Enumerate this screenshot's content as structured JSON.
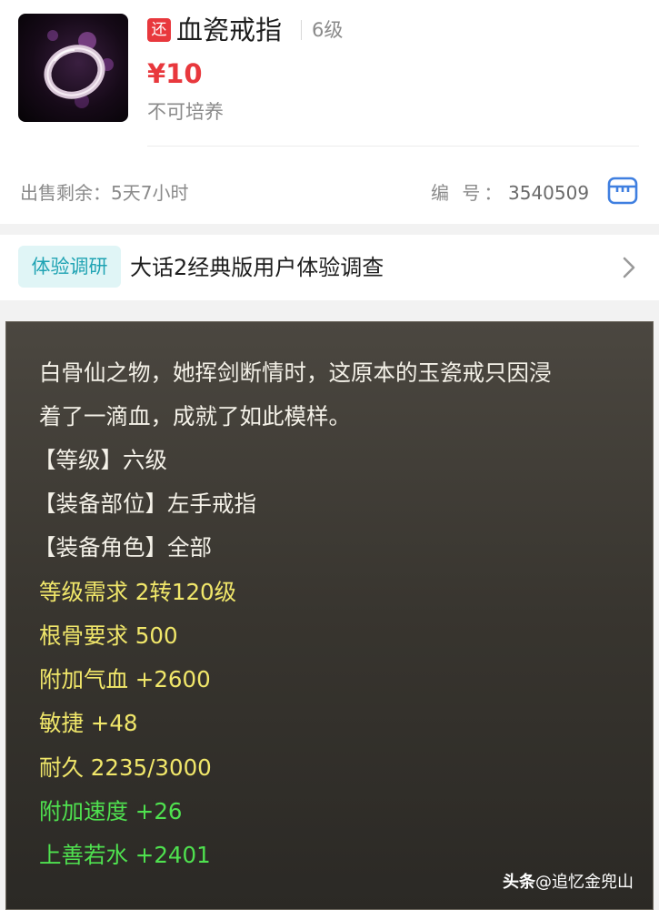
{
  "item": {
    "tag": "还",
    "name": "血瓷戒指",
    "level": "6级",
    "price": "¥10",
    "trainable": "不可培养",
    "remaining": "出售剩余：5天7小时",
    "serial_label": "编 号：",
    "serial_value": "3540509"
  },
  "survey": {
    "tag": "体验调研",
    "text": "大话2经典版用户体验调查"
  },
  "description": {
    "lines": [
      "白骨仙之物，她挥剑断情时，这原本的玉瓷戒只因浸",
      "着了一滴血，成就了如此模样。",
      "【等级】六级",
      "【装备部位】左手戒指",
      "【装备角色】全部"
    ],
    "requirements": [
      "等级需求 2转120级",
      "根骨要求 500"
    ],
    "stats": [
      "附加气血 +2600",
      "敏捷 +48",
      "耐久 2235/3000"
    ],
    "special": [
      "附加速度 +26",
      "上善若水 +2401"
    ]
  },
  "watermark": {
    "brand": "头条",
    "account": "@追忆金兜山"
  },
  "colors": {
    "price_red": "#e8383d",
    "survey_teal": "#1fa3b3",
    "stat_yellow": "#f1e76a",
    "stat_green": "#4fe14f"
  }
}
